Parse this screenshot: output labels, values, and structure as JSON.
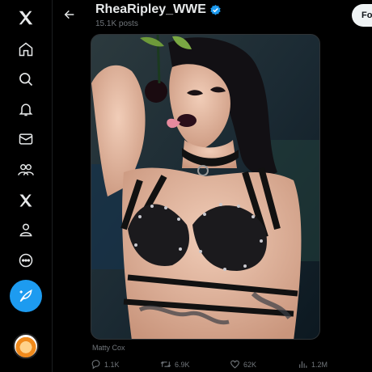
{
  "header": {
    "display_name": "RheaRipley_WWE",
    "posts_count": "15.1K posts",
    "follow_label": "Follow"
  },
  "nav": {
    "items": [
      {
        "icon": "x-logo-icon"
      },
      {
        "icon": "home-icon"
      },
      {
        "icon": "search-icon"
      },
      {
        "icon": "notifications-bell-icon"
      },
      {
        "icon": "messages-envelope-icon"
      },
      {
        "icon": "communities-icon"
      },
      {
        "icon": "premium-x-icon"
      },
      {
        "icon": "profile-icon"
      },
      {
        "icon": "more-circle-icon"
      }
    ],
    "compose_icon": "compose-feather-icon",
    "accent": "#1d9bf0"
  },
  "post": {
    "photo_credit": "Matty Cox",
    "replies": "1.1K",
    "reposts": "6.9K",
    "likes": "62K",
    "views": "1.2M"
  },
  "colors": {
    "background": "#000000",
    "text": "#e7e9ea",
    "muted": "#71767b",
    "verified": "#1d9bf0"
  }
}
